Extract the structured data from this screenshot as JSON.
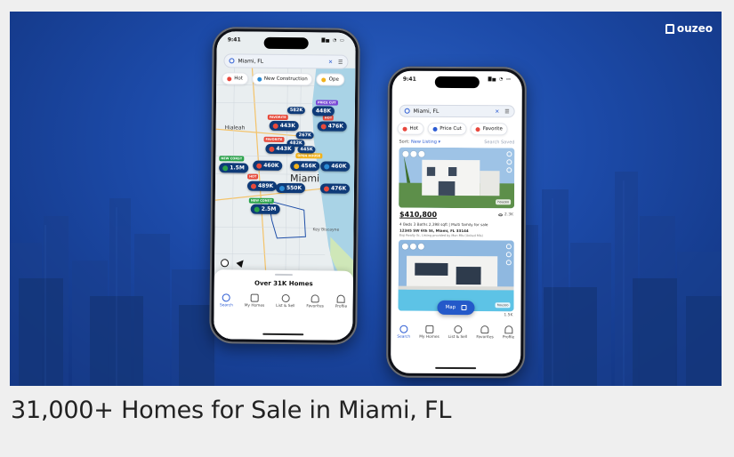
{
  "brand": {
    "name": "ouzeo",
    "mark_letter": "h"
  },
  "caption": "31,000+ Homes for Sale in Miami, FL",
  "colors": {
    "hero_bg": "#1c4aa8",
    "accent": "#2b5bd3",
    "pin": "#0e3a78"
  },
  "left_phone": {
    "time": "9:41",
    "signal": "▇▅ ◔ ▭",
    "search_value": "Miami, FL",
    "clear_icon": "✕",
    "filter_icon": "☰",
    "chips": [
      {
        "label": "Hot",
        "icon": "flame-icon",
        "color": "#e8463c"
      },
      {
        "label": "New Construction",
        "icon": "building-icon",
        "color": "#2b8ad3"
      },
      {
        "label": "Ope",
        "icon": "open-house-icon",
        "color": "#f2b21b"
      }
    ],
    "map_labels": {
      "city1": "Hialeah",
      "city2": "Miami",
      "area": "Key Biscayne"
    },
    "pins": [
      {
        "label": "582K"
      },
      {
        "label": "448K"
      },
      {
        "label": "443K"
      },
      {
        "label": "476K"
      },
      {
        "label": "267K"
      },
      {
        "label": "482K"
      },
      {
        "label": "443K"
      },
      {
        "label": "445K"
      },
      {
        "label": "1.5M"
      },
      {
        "label": "460K"
      },
      {
        "label": "456K"
      },
      {
        "label": "460K"
      },
      {
        "label": "489K"
      },
      {
        "label": "550K"
      },
      {
        "label": "476K"
      },
      {
        "label": "2.5M"
      }
    ],
    "tags": [
      "PRICE CUT",
      "FAVORITE",
      "HOT",
      "FAVORITE",
      "NEW CONST",
      "OPEN HOUSE",
      "HOT",
      "NEW CONST"
    ],
    "sheet_title": "Over 31K Homes",
    "tabs": [
      {
        "label": "Search",
        "icon": "search-icon",
        "active": true
      },
      {
        "label": "My Homes",
        "icon": "home-icon",
        "active": false
      },
      {
        "label": "List & Sell",
        "icon": "list-sell-icon",
        "active": false
      },
      {
        "label": "Favorites",
        "icon": "heart-icon",
        "active": false
      },
      {
        "label": "Profile",
        "icon": "person-icon",
        "active": false
      }
    ]
  },
  "right_phone": {
    "time": "9:41",
    "signal": "▇▅ ◔ ▭",
    "search_value": "Miami, FL",
    "clear_icon": "✕",
    "filter_icon": "☰",
    "chips": [
      {
        "label": "Hot",
        "icon": "flame-icon",
        "color": "#e8463c"
      },
      {
        "label": "Price Cut",
        "icon": "price-cut-icon",
        "color": "#2b5bd3"
      },
      {
        "label": "Favorite",
        "icon": "heart-icon",
        "color": "#e8463c"
      }
    ],
    "sort_label": "Sort:",
    "sort_value": "New Listing ▾",
    "save_search": "Search Saved",
    "listing1": {
      "price": "$410,800",
      "specs": "4 Beds  3 Baths  2,398 sqft  |  Multi family for sale",
      "address": "12345 SW 6th St, Miami, FL 33144",
      "broker": "Exp Realty llc, Listing provided by Mon Mls (United Mls)",
      "watermark": "houzeo",
      "views": "2.3K"
    },
    "listing2": {
      "watermark": "houzeo",
      "views": "1.5K"
    },
    "map_button": "Map",
    "tabs": [
      {
        "label": "Search",
        "icon": "search-icon",
        "active": true
      },
      {
        "label": "My Homes",
        "icon": "home-icon",
        "active": false
      },
      {
        "label": "List & Sell",
        "icon": "list-sell-icon",
        "active": false
      },
      {
        "label": "Favorites",
        "icon": "heart-icon",
        "active": false
      },
      {
        "label": "Profile",
        "icon": "person-icon",
        "active": false
      }
    ]
  }
}
